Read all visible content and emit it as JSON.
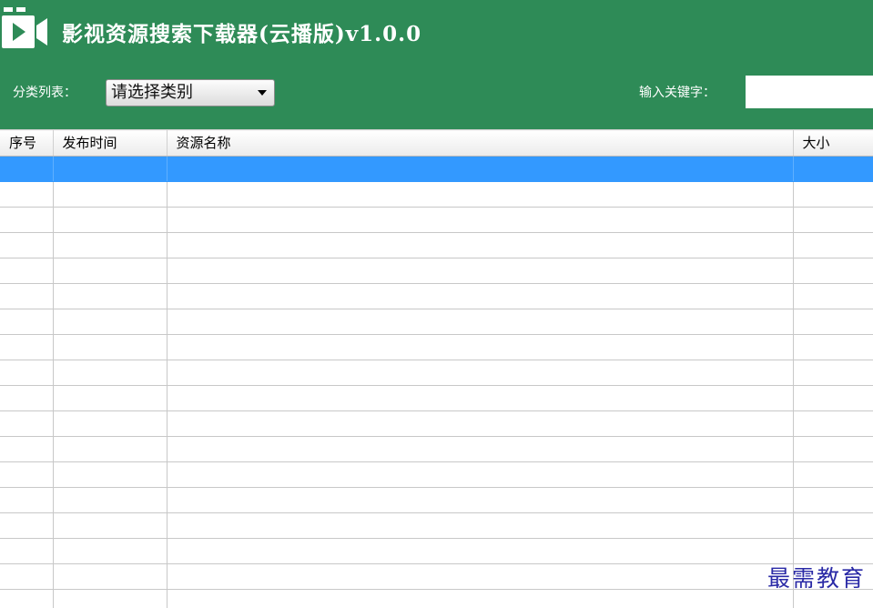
{
  "app": {
    "title": "影视资源搜索下载器(云播版)v1.0.0",
    "icon": "video-camera-icon"
  },
  "toolbar": {
    "category_label": "分类列表：",
    "category_selected": "请选择类别",
    "keyword_label": "输入关键字：",
    "keyword_value": ""
  },
  "table": {
    "columns": [
      "序号",
      "发布时间",
      "资源名称",
      "大小"
    ],
    "rows": [],
    "selected_row_index": 0
  },
  "watermark": "最需教育",
  "colors": {
    "header_bg": "#2e8b57",
    "selection": "#3399ff",
    "watermark": "#2a2aa6"
  }
}
